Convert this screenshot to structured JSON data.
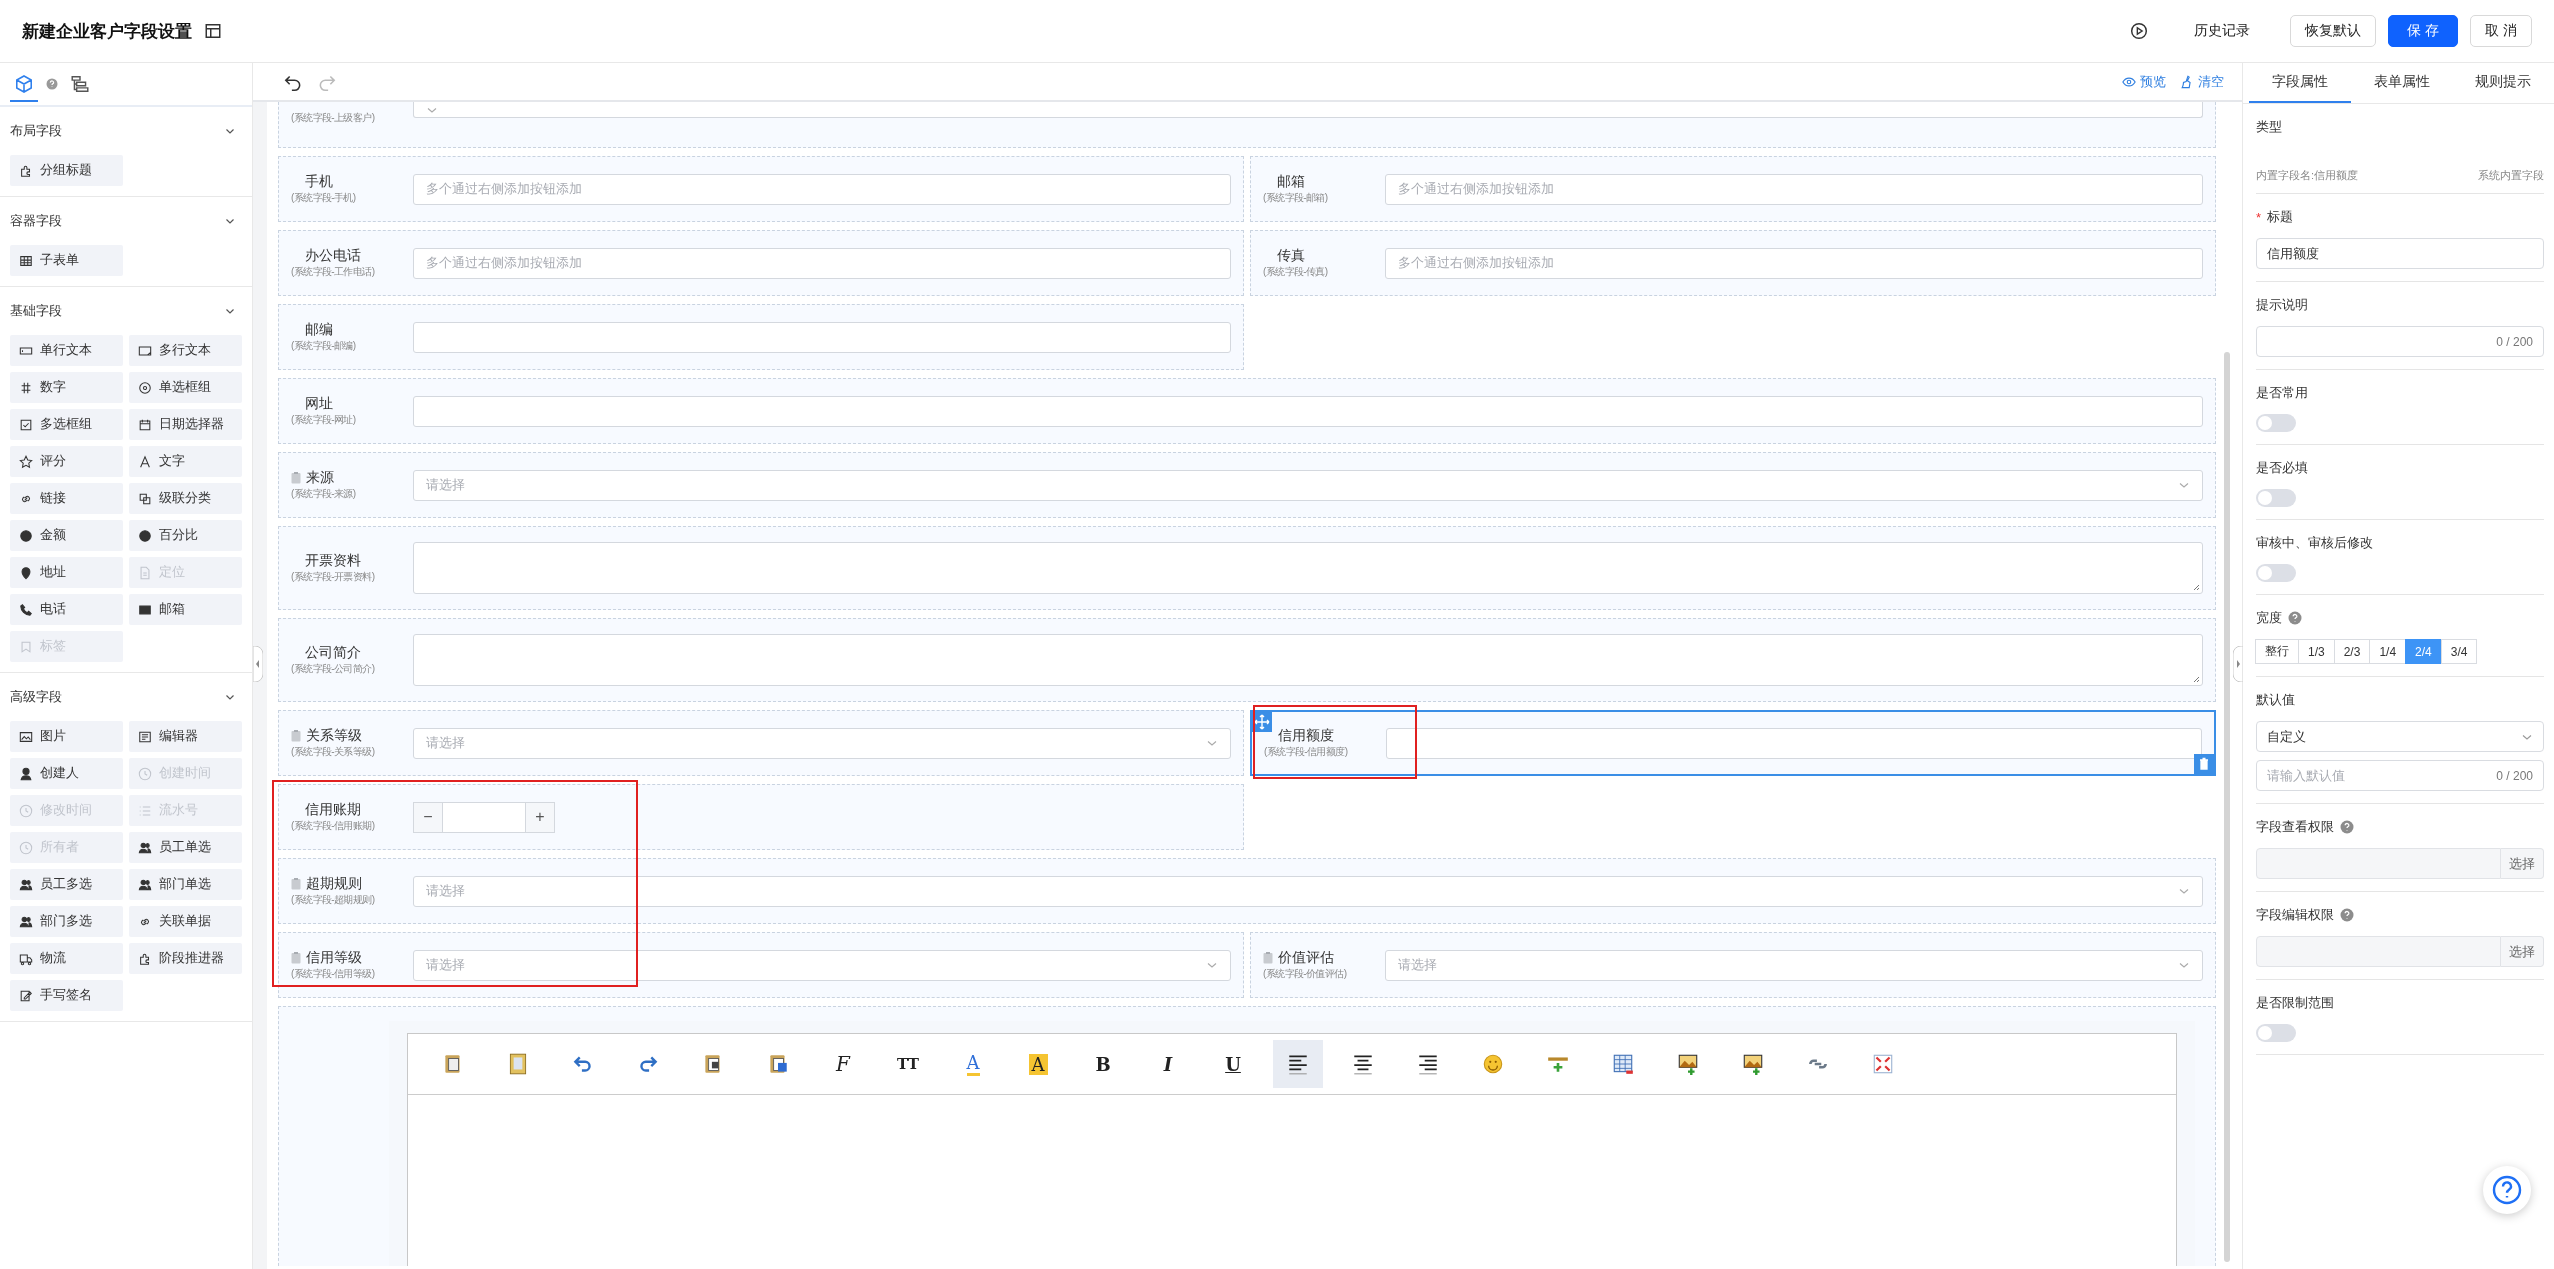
{
  "header": {
    "title": "新建企业客户字段设置",
    "actions": [
      {
        "kind": "icon"
      },
      {
        "kind": "text",
        "label": "历史记录"
      },
      {
        "kind": "default",
        "label": "恢复默认"
      },
      {
        "kind": "primary",
        "label": "保 存"
      },
      {
        "kind": "default",
        "label": "取 消"
      }
    ]
  },
  "sidebar": {
    "tabs": [
      {
        "kind": "cube",
        "selected": true
      },
      {
        "kind": "help",
        "selected": false
      },
      {
        "kind": "tree",
        "selected": false
      }
    ],
    "sections": [
      {
        "title": "布局字段",
        "expanded": true,
        "items": [
          {
            "label": "分组标题",
            "kind": "heading",
            "disabled": false
          }
        ]
      },
      {
        "title": "容器字段",
        "expanded": true,
        "items": [
          {
            "label": "子表单",
            "kind": "table",
            "disabled": false
          }
        ]
      },
      {
        "title": "基础字段",
        "expanded": true,
        "items": [
          {
            "label": "单行文本",
            "kind": "input",
            "disabled": false
          },
          {
            "label": "多行文本",
            "kind": "textarea",
            "disabled": false
          },
          {
            "label": "数字",
            "kind": "number",
            "disabled": false
          },
          {
            "label": "单选框组",
            "kind": "radio",
            "disabled": false
          },
          {
            "label": "多选框组",
            "kind": "checkbox",
            "disabled": false
          },
          {
            "label": "日期选择器",
            "kind": "date",
            "disabled": false
          },
          {
            "label": "评分",
            "kind": "star",
            "disabled": false
          },
          {
            "label": "文字",
            "kind": "letter",
            "disabled": false
          },
          {
            "label": "链接",
            "kind": "link",
            "disabled": false
          },
          {
            "label": "级联分类",
            "kind": "cascade",
            "disabled": false
          },
          {
            "label": "金额",
            "kind": "coin",
            "disabled": false
          },
          {
            "label": "百分比",
            "kind": "coin",
            "disabled": false
          },
          {
            "label": "地址",
            "kind": "pin",
            "disabled": false
          },
          {
            "label": "定位",
            "kind": "file",
            "disabled": true
          },
          {
            "label": "电话",
            "kind": "phone",
            "disabled": false
          },
          {
            "label": "邮箱",
            "kind": "mail",
            "disabled": false
          },
          {
            "label": "标签",
            "kind": "tag",
            "disabled": true
          }
        ]
      },
      {
        "title": "高级字段",
        "expanded": true,
        "items": [
          {
            "label": "图片",
            "kind": "image",
            "disabled": false
          },
          {
            "label": "编辑器",
            "kind": "editor",
            "disabled": false
          },
          {
            "label": "创建人",
            "kind": "user",
            "disabled": false
          },
          {
            "label": "创建时间",
            "kind": "clock",
            "disabled": true
          },
          {
            "label": "修改时间",
            "kind": "clock",
            "disabled": true
          },
          {
            "label": "流水号",
            "kind": "list",
            "disabled": true
          },
          {
            "label": "所有者",
            "kind": "clock",
            "disabled": true
          },
          {
            "label": "员工单选",
            "kind": "users",
            "disabled": false
          },
          {
            "label": "员工多选",
            "kind": "users",
            "disabled": false
          },
          {
            "label": "部门单选",
            "kind": "users",
            "disabled": false
          },
          {
            "label": "部门多选",
            "kind": "users",
            "disabled": false
          },
          {
            "label": "关联单据",
            "kind": "link",
            "disabled": false
          },
          {
            "label": "物流",
            "kind": "truck",
            "disabled": false
          },
          {
            "label": "阶段推进器",
            "kind": "heading",
            "disabled": false
          },
          {
            "label": "手写签名",
            "kind": "sign",
            "disabled": false
          }
        ]
      }
    ]
  },
  "toolbar": {
    "history": [
      {
        "kind": "undo",
        "disabled": false
      },
      {
        "kind": "redo",
        "disabled": true
      }
    ],
    "actions": [
      {
        "kind": "preview",
        "label": "预览"
      },
      {
        "kind": "clear",
        "label": "清空"
      }
    ]
  },
  "canvas": {
    "rows": [
      {
        "kind": "full",
        "fields": [
          {
            "sublabel": "(系统字段-上级客户)",
            "kind": "select",
            "selected": false
          }
        ]
      },
      {
        "kind": "half",
        "fields": [
          {
            "label": "手机",
            "sublabel": "(系统字段-手机)",
            "kind": "input",
            "placeholder": "多个通过右侧添加按钮添加",
            "locked": false,
            "selected": false
          },
          {
            "label": "邮箱",
            "sublabel": "(系统字段-邮箱)",
            "kind": "input",
            "placeholder": "多个通过右侧添加按钮添加",
            "locked": false,
            "selected": false
          }
        ]
      },
      {
        "kind": "half",
        "fields": [
          {
            "label": "办公电话",
            "sublabel": "(系统字段-工作电话)",
            "kind": "input",
            "placeholder": "多个通过右侧添加按钮添加",
            "locked": false,
            "selected": false
          },
          {
            "label": "传真",
            "sublabel": "(系统字段-传真)",
            "kind": "input",
            "placeholder": "多个通过右侧添加按钮添加",
            "locked": false,
            "selected": false
          }
        ]
      },
      {
        "kind": "half",
        "fields": [
          {
            "label": "邮编",
            "sublabel": "(系统字段-邮编)",
            "kind": "input",
            "locked": false,
            "selected": false
          }
        ]
      },
      {
        "kind": "full",
        "fields": [
          {
            "label": "网址",
            "sublabel": "(系统字段-网址)",
            "kind": "input",
            "locked": false,
            "selected": false
          }
        ]
      },
      {
        "kind": "full",
        "fields": [
          {
            "label": "来源",
            "sublabel": "(系统字段-来源)",
            "kind": "select",
            "placeholder": "请选择",
            "locked": true,
            "selected": false
          }
        ]
      },
      {
        "kind": "full",
        "fields": [
          {
            "label": "开票资料",
            "sublabel": "(系统字段-开票资料)",
            "kind": "textarea",
            "locked": false,
            "selected": false
          }
        ]
      },
      {
        "kind": "full",
        "fields": [
          {
            "label": "公司简介",
            "sublabel": "(系统字段-公司简介)",
            "kind": "textarea",
            "locked": false,
            "selected": false
          }
        ]
      },
      {
        "kind": "half",
        "fields": [
          {
            "label": "关系等级",
            "sublabel": "(系统字段-关系等级)",
            "kind": "select",
            "placeholder": "请选择",
            "locked": true,
            "selected": false
          },
          {
            "label": "信用额度",
            "sublabel": "(系统字段-信用额度)",
            "kind": "input",
            "locked": false,
            "selected": true
          }
        ]
      },
      {
        "kind": "half",
        "fields": [
          {
            "label": "信用账期",
            "sublabel": "(系统字段-信用账期)",
            "kind": "number",
            "minus": "−",
            "plus": "+",
            "locked": false,
            "selected": false
          }
        ]
      },
      {
        "kind": "full",
        "fields": [
          {
            "label": "超期规则",
            "sublabel": "(系统字段-超期规则)",
            "kind": "select",
            "placeholder": "请选择",
            "locked": true,
            "selected": false
          }
        ]
      },
      {
        "kind": "half",
        "fields": [
          {
            "label": "信用等级",
            "sublabel": "(系统字段-信用等级)",
            "kind": "select",
            "placeholder": "请选择",
            "locked": true,
            "selected": false
          },
          {
            "label": "价值评估",
            "sublabel": "(系统字段-价值评估)",
            "kind": "select",
            "placeholder": "请选择",
            "locked": true,
            "selected": false
          }
        ]
      }
    ]
  },
  "editor": {
    "tools": [
      {
        "kind": "paste"
      },
      {
        "kind": "template"
      },
      {
        "kind": "undo"
      },
      {
        "kind": "redo"
      },
      {
        "kind": "paste-text"
      },
      {
        "kind": "paste-word"
      },
      {
        "kind": "font",
        "label": "F"
      },
      {
        "kind": "font-size",
        "label": "TT"
      },
      {
        "kind": "font-color",
        "label": "A"
      },
      {
        "kind": "back-color",
        "label": "A"
      },
      {
        "kind": "bold",
        "label": "B"
      },
      {
        "kind": "italic",
        "label": "I"
      },
      {
        "kind": "underline",
        "label": "U"
      },
      {
        "kind": "align-left",
        "selected": true
      },
      {
        "kind": "align-center",
        "selected": false
      },
      {
        "kind": "align-right",
        "selected": false
      },
      {
        "kind": "emoji"
      },
      {
        "kind": "rule"
      },
      {
        "kind": "table"
      },
      {
        "kind": "image"
      },
      {
        "kind": "images"
      },
      {
        "kind": "link"
      },
      {
        "kind": "fullscreen"
      }
    ]
  },
  "panel": {
    "tabs": [
      {
        "label": "字段属性",
        "selected": true
      },
      {
        "label": "表单属性",
        "selected": false
      },
      {
        "label": "规则提示",
        "selected": false
      }
    ],
    "type": {
      "label": "类型",
      "builtin_name": "内置字段名:信用额度",
      "source": "系统内置字段"
    },
    "properties": [
      {
        "kind": "input",
        "label": "标题",
        "mark": "*",
        "value": "信用额度"
      },
      {
        "kind": "counter-input",
        "label": "提示说明",
        "counter": "0 / 200"
      },
      {
        "kind": "toggle",
        "label": "是否常用",
        "on": false
      },
      {
        "kind": "toggle",
        "label": "是否必填",
        "on": false
      },
      {
        "kind": "toggle",
        "label": "审核中、审核后修改",
        "on": false
      },
      {
        "kind": "segments",
        "label": "宽度",
        "help": true,
        "options": [
          {
            "label": "整行",
            "selected": false
          },
          {
            "label": "1/3",
            "selected": false
          },
          {
            "label": "2/3",
            "selected": false
          },
          {
            "label": "1/4",
            "selected": false
          },
          {
            "label": "2/4",
            "selected": true
          },
          {
            "label": "3/4",
            "selected": false
          }
        ]
      },
      {
        "kind": "default",
        "label": "默认值",
        "select": "自定义",
        "placeholder": "请输入默认值",
        "counter": "0 / 200"
      },
      {
        "kind": "picker",
        "label": "字段查看权限",
        "help": true,
        "button": "选择"
      },
      {
        "kind": "picker",
        "label": "字段编辑权限",
        "help": true,
        "button": "选择"
      },
      {
        "kind": "toggle",
        "label": "是否限制范围",
        "on": false
      }
    ]
  }
}
